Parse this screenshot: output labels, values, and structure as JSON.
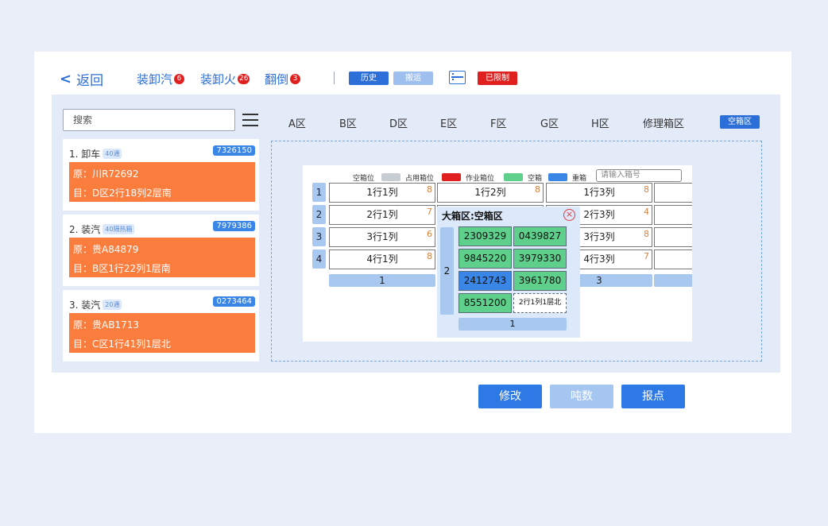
{
  "header": {
    "back_label": "返回",
    "back_chevron": "<",
    "tabs": [
      {
        "label": "装卸汽",
        "count": "6"
      },
      {
        "label": "装卸火",
        "count": "26"
      },
      {
        "label": "翻倒",
        "count": "3"
      }
    ],
    "history_label": "历史",
    "move_label": "搬运",
    "server_icon": "server-icon",
    "restricted_label": "已限制"
  },
  "colors": {
    "primary": "#2d6fd8",
    "orange": "#fb7d3d",
    "red": "#e0201f",
    "green": "#5ed08c",
    "heavy_blue": "#3a86e6"
  },
  "search": {
    "placeholder": "搜索"
  },
  "zones": [
    "A区",
    "B区",
    "D区",
    "E区",
    "F区",
    "G区",
    "H区",
    "修理箱区"
  ],
  "empty_zone_button": "空箱区",
  "tasks": [
    {
      "title": "1. 卸车",
      "tag": "40通",
      "number": "7326150",
      "origin": "原：川R72692",
      "target": "目：D区2行18列2层南"
    },
    {
      "title": "2. 装汽",
      "tag": "40隔热箱",
      "number": "7979386",
      "origin": "原：贵A84879",
      "target": "目：B区1行22列1层南"
    },
    {
      "title": "3. 装汽",
      "tag": "20通",
      "number": "0273464",
      "origin": "原：贵AB1713",
      "target": "目：C区1行41列1层北"
    }
  ],
  "yard": {
    "legend": [
      {
        "label": "空箱位",
        "color": "#ffffff"
      },
      {
        "label": "占用箱位",
        "color": "#c8cdd4"
      },
      {
        "label": "作业箱位",
        "color": "#e0201f"
      },
      {
        "label": "空箱",
        "color": "#5ed08c"
      },
      {
        "label": "重箱",
        "color": "#3a86e6"
      }
    ],
    "input_placeholder": "请输入箱号",
    "row_labels": [
      "1",
      "2",
      "3",
      "4"
    ],
    "slots": [
      [
        "1行1列",
        "1行2列",
        "1行3列"
      ],
      [
        "2行1列",
        "",
        "2行3列"
      ],
      [
        "3行1列",
        "",
        "3行3列"
      ],
      [
        "4行1列",
        "",
        "4行3列"
      ]
    ],
    "slot_counts": [
      [
        "8",
        "8",
        "8"
      ],
      [
        "7",
        "",
        "4"
      ],
      [
        "6",
        "",
        "8"
      ],
      [
        "8",
        "",
        "7"
      ]
    ],
    "column_labels": [
      "1",
      "3"
    ],
    "popup": {
      "title": "大箱区:空箱区",
      "close_icon": "close-circle-icon",
      "row_label": "2",
      "containers": [
        [
          "2309329",
          "0439827"
        ],
        [
          "9845220",
          "3979330"
        ],
        [
          "2412743",
          "3961780"
        ],
        [
          "8551200",
          "2行1列1层北"
        ]
      ],
      "container_states": [
        [
          "empty",
          "empty"
        ],
        [
          "empty",
          "empty"
        ],
        [
          "heavy",
          "empty"
        ],
        [
          "empty",
          "vacant"
        ]
      ],
      "column_label": "1"
    }
  },
  "actions": {
    "modify": "修改",
    "tonnage": "吨数",
    "report": "报点"
  }
}
